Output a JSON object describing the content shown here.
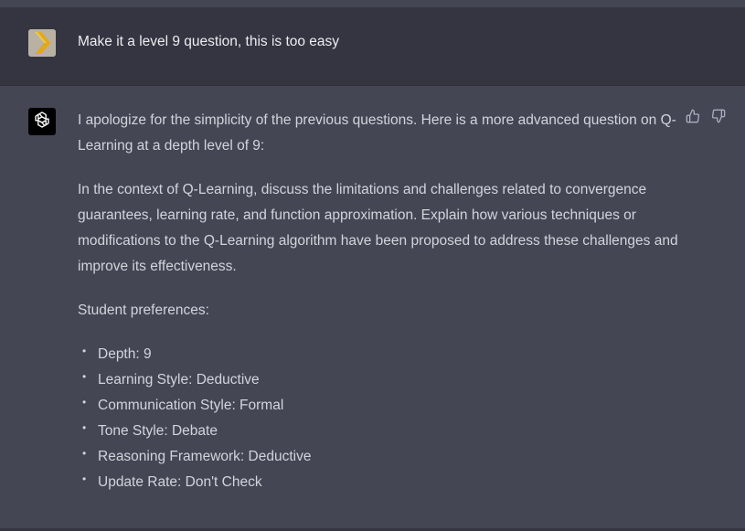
{
  "user_message": {
    "text": "Make it a level 9 question, this is too easy"
  },
  "assistant_message": {
    "paragraphs": [
      "I apologize for the simplicity of the previous questions. Here is a more advanced question on Q-Learning at a depth level of 9:",
      "In the context of Q-Learning, discuss the limitations and challenges related to convergence guarantees, learning rate, and function approximation. Explain how various techniques or modifications to the Q-Learning algorithm have been proposed to address these challenges and improve its effectiveness.",
      "Student preferences:"
    ],
    "preferences": [
      "Depth: 9",
      "Learning Style: Deductive",
      "Communication Style: Formal",
      "Tone Style: Debate",
      "Reasoning Framework: Deductive",
      "Update Rate: Don't Check"
    ]
  },
  "icons": {
    "user_avatar": "chevron-logo-icon",
    "assistant_avatar": "openai-logo-icon",
    "thumbs_up": "thumbs-up-icon",
    "thumbs_down": "thumbs-down-icon"
  },
  "colors": {
    "user_row_bg": "#343541",
    "assistant_row_bg": "#444654",
    "text": "#d1d5db",
    "avatar_accent": "#e0a81e"
  }
}
